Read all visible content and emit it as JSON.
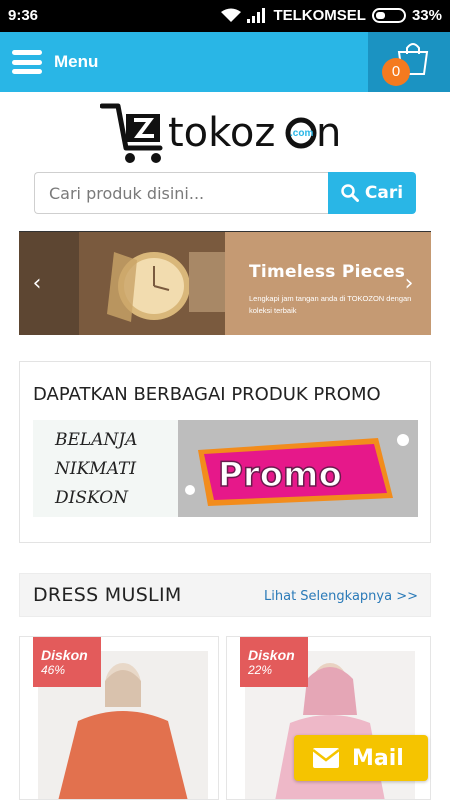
{
  "status_bar": {
    "time": "9:36",
    "carrier": "TELKOMSEL",
    "battery": "33%"
  },
  "appbar": {
    "menu_label": "Menu",
    "cart_count": "0",
    "color": "#29b6e6",
    "cart_bg": "#1b93c2"
  },
  "logo": {
    "text": "tokozon",
    "suffix": ".com"
  },
  "search": {
    "placeholder": "Cari produk disini...",
    "button_label": "Cari"
  },
  "banner": {
    "title": "Timeless Pieces",
    "subtitle": "Lengkapi jam tangan anda di TOKOZON dengan koleksi terbaik"
  },
  "promo": {
    "title": "DAPATKAN BERBAGAI PRODUK PROMO",
    "lines": [
      "BELANJA",
      "NIKMATI",
      "DISKON"
    ],
    "badge_text": "Promo"
  },
  "dress_section": {
    "title": "DRESS MUSLIM",
    "link": "Lihat Selengkapnya >>"
  },
  "products": [
    {
      "discount_label": "Diskon",
      "discount_value": "46%"
    },
    {
      "discount_label": "Diskon",
      "discount_value": "22%"
    }
  ],
  "mail_button": {
    "label": "Mail",
    "color": "#f5c400"
  }
}
